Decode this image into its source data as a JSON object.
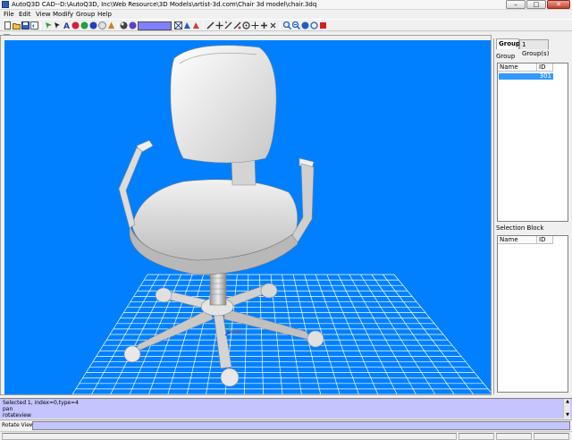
{
  "window": {
    "title": "AutoQ3D CAD--D:\\AutoQ3D, Inc\\Web Resource\\3D Models\\artist-3d.com\\Chair 3d model\\chair.3dq",
    "minimize_glyph": "–",
    "maximize_glyph": "□",
    "close_glyph": "✕"
  },
  "menubar": {
    "items": [
      "File",
      "Edit",
      "View",
      "Modify",
      "Group",
      "Help"
    ]
  },
  "toolbar": {
    "groups": [
      [
        "new-file-icon",
        "open-file-icon",
        "save-icon",
        "undo-icon"
      ],
      [
        "select-icon",
        "arrow-icon",
        "text-icon",
        "sphere-icon",
        "box-icon",
        "cylinder-icon",
        "cone-icon",
        "torus-icon"
      ],
      [
        "color-swatch-icon",
        "palette-icon",
        "texture-icon"
      ],
      [
        "scale-icon",
        "move-icon",
        "rotate-icon",
        "mirror-icon",
        "copy-icon",
        "circle-icon",
        "array-icon",
        "delete-icon"
      ],
      [
        "zoom-in-icon",
        "zoom-out-icon",
        "pan-icon",
        "rotate-view-icon",
        "fit-icon",
        "render-icon"
      ]
    ],
    "current_color": "#8080ff"
  },
  "viewport": {
    "background": "#0080ff",
    "grid_color": "#ffffff",
    "model_color": "#e4e4e4"
  },
  "right_panel": {
    "tabs": [
      {
        "label": "Group",
        "active": true
      },
      {
        "label": "1 Group(s)",
        "active": false
      }
    ],
    "group_section": {
      "title": "Group",
      "columns": [
        "Name",
        "ID"
      ],
      "rows": [
        {
          "name": "",
          "id": "301",
          "selected": true
        }
      ]
    },
    "selection_section": {
      "title": "Selection Block",
      "columns": [
        "Name",
        "ID"
      ],
      "rows": []
    }
  },
  "console": {
    "lines": [
      "Selected 1, index=0,type=4",
      "pan",
      "rotateview"
    ],
    "scroll_up": "▲",
    "scroll_down": "▼"
  },
  "command": {
    "label": "Rotate View:",
    "value": ""
  }
}
